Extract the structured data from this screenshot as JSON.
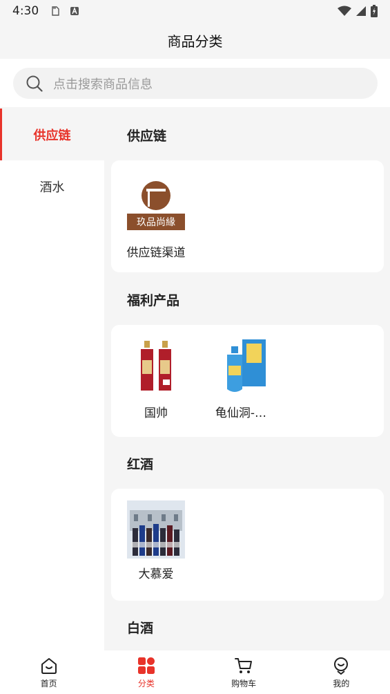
{
  "status_bar": {
    "time": "4:30"
  },
  "header": {
    "title": "商品分类"
  },
  "search": {
    "placeholder": "点击搜索商品信息"
  },
  "sidebar": {
    "items": [
      {
        "label": "供应链",
        "active": true
      },
      {
        "label": "酒水",
        "active": false
      }
    ]
  },
  "sections": [
    {
      "title": "供应链",
      "products": [
        {
          "name": "供应链渠道",
          "logo_text": "玖品尚緣"
        }
      ]
    },
    {
      "title": "福利产品",
      "products": [
        {
          "name": "国帅"
        },
        {
          "name": "龟仙洞-…"
        }
      ]
    },
    {
      "title": "红酒",
      "products": [
        {
          "name": "大慕爱"
        }
      ]
    },
    {
      "title": "白酒"
    }
  ],
  "tabbar": {
    "items": [
      {
        "label": "首页",
        "icon": "home-icon"
      },
      {
        "label": "分类",
        "icon": "category-icon",
        "active": true
      },
      {
        "label": "购物车",
        "icon": "cart-icon"
      },
      {
        "label": "我的",
        "icon": "profile-icon"
      }
    ]
  },
  "colors": {
    "accent": "#e8332a",
    "background": "#f5f5f5",
    "card": "#ffffff"
  }
}
